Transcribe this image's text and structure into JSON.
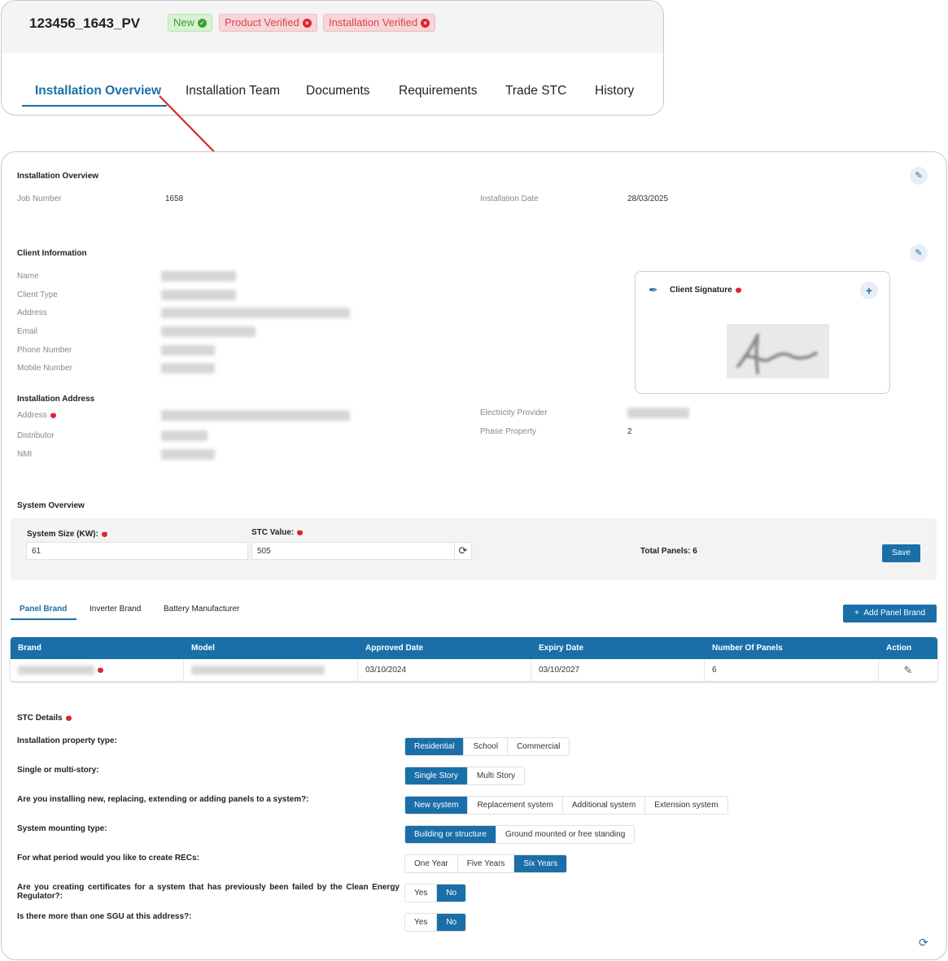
{
  "header": {
    "job_title": "123456_1643_PV",
    "badges": {
      "new": "New",
      "product_verified": "Product Verified",
      "installation_verified": "Installation Verified"
    },
    "tabs": [
      "Installation Overview",
      "Installation Team",
      "Documents",
      "Requirements",
      "Trade STC",
      "History"
    ],
    "active_tab": "Installation Overview"
  },
  "installation_overview": {
    "title": "Installation Overview",
    "job_number_label": "Job Number",
    "job_number": "1658",
    "installation_date_label": "Installation Date",
    "installation_date": "28/03/2025"
  },
  "client_information": {
    "title": "Client Information",
    "labels": {
      "name": "Name",
      "client_type": "Client Type",
      "address": "Address",
      "email": "Email",
      "phone": "Phone Number",
      "mobile": "Mobile Number"
    },
    "signature_title": "Client Signature"
  },
  "installation_address": {
    "title": "Installation Address",
    "address_label": "Address",
    "distributor_label": "Distributor",
    "nmi_label": "NMI",
    "electricity_provider_label": "Electricity Provider",
    "phase_property_label": "Phase Property",
    "phase_property": "2"
  },
  "system_overview": {
    "title": "System Overview",
    "system_size_label": "System Size (KW):",
    "system_size": "61",
    "stc_value_label": "STC Value:",
    "stc_value": "505",
    "total_panels": "Total Panels: 6",
    "save_label": "Save"
  },
  "brand_tabs": {
    "tabs": [
      "Panel Brand",
      "Inverter Brand",
      "Battery Manufacturer"
    ],
    "active": "Panel Brand",
    "add_label": "Add Panel Brand"
  },
  "panel_table": {
    "columns": [
      "Brand",
      "Model",
      "Approved Date",
      "Expiry Date",
      "Number Of Panels",
      "Action"
    ],
    "rows": [
      {
        "approved": "03/10/2024",
        "expiry": "03/10/2027",
        "panels": "6"
      }
    ]
  },
  "stc_details": {
    "title": "STC Details",
    "questions": [
      {
        "q": "Installation property type:",
        "options": [
          "Residential",
          "School",
          "Commercial"
        ],
        "selected": 0
      },
      {
        "q": "Single or multi-story:",
        "options": [
          "Single Story",
          "Multi Story"
        ],
        "selected": 0
      },
      {
        "q": "Are you installing new, replacing, extending or adding panels to a system?:",
        "options": [
          "New system",
          "Replacement system",
          "Additional system",
          "Extension system"
        ],
        "selected": 0
      },
      {
        "q": "System mounting type:",
        "options": [
          "Building or structure",
          "Ground mounted or free standing"
        ],
        "selected": 0
      },
      {
        "q": "For what period would you like to create RECs:",
        "options": [
          "One Year",
          "Five Years",
          "Six Years"
        ],
        "selected": 2
      },
      {
        "q": "Are you creating certificates for a system that has previously been failed by the Clean Energy Regulator?:",
        "options": [
          "Yes",
          "No"
        ],
        "selected": 1
      },
      {
        "q": "Is there more than one SGU at this address?:",
        "options": [
          "Yes",
          "No"
        ],
        "selected": 1
      }
    ]
  },
  "colors": {
    "primary": "#1a6fa8",
    "success": "#3aa234",
    "danger": "#d9262f",
    "arrow": "#d42a2a"
  }
}
